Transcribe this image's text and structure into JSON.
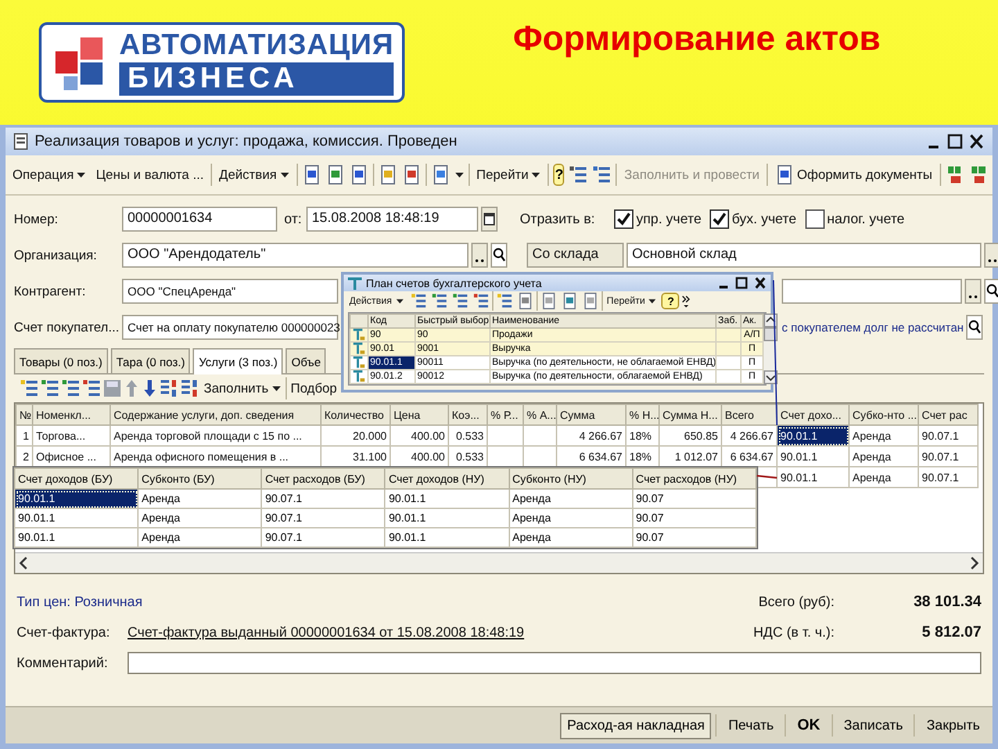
{
  "slide": {
    "title": "Формирование актов",
    "logo_top": "АВТОМАТИЗАЦИЯ",
    "logo_bottom": "БИЗНЕСА"
  },
  "window": {
    "title": "Реализация товаров и услуг: продажа, комиссия. Проведен"
  },
  "toolbar": {
    "operation": "Операция",
    "prices": "Цены и валюта ...",
    "actions": "Действия",
    "goto": "Перейти",
    "help": "?",
    "fill_post": "Заполнить и провести",
    "make_docs": "Оформить документы"
  },
  "form": {
    "number_label": "Номер:",
    "number": "00000001634",
    "date_label": "от:",
    "date": "15.08.2008 18:48:19",
    "reflect_label": "Отразить в:",
    "reflect": [
      {
        "label": "упр. учете",
        "checked": true
      },
      {
        "label": "бух. учете",
        "checked": true
      },
      {
        "label": "налог. учете",
        "checked": false
      }
    ],
    "org_label": "Организация:",
    "org": "ООО \"Арендодатель\"",
    "warehouse_label": "Со склада",
    "warehouse": "Основной склад",
    "contractor_label": "Контрагент:",
    "contractor": "ООО \"СпецАренда\"",
    "invoice_label": "Счет покупател...",
    "invoice": "Счет на оплату покупателю 000000023",
    "debt_note": "с покупателем долг не рассчитан"
  },
  "tabs": [
    {
      "label": "Товары (0 поз.)",
      "selected": false
    },
    {
      "label": "Тара (0 поз.)",
      "selected": false
    },
    {
      "label": "Услуги (3 поз.)",
      "selected": true
    },
    {
      "label": "Объе",
      "selected": false
    }
  ],
  "table_toolbar": {
    "fill": "Заполнить",
    "pick": "Подбор"
  },
  "table": {
    "columns": [
      "№",
      "Номенкл...",
      "Содержание услуги, доп. сведения",
      "Количество",
      "Цена",
      "Коэ...",
      "% Р...",
      "% А...",
      "Сумма",
      "% Н...",
      "Сумма Н...",
      "Всего",
      "Счет дохо...",
      "Субко-нто ...",
      "Счет рас"
    ],
    "rows": [
      {
        "selected": true,
        "cells": [
          "1",
          "Торгова...",
          "Аренда торговой площади с 15 по ...",
          "20.000",
          "400.00",
          "0.533",
          null,
          null,
          "4 266.67",
          "18%",
          "650.85",
          "4 266.67",
          "90.01.1",
          "Аренда",
          "90.07.1"
        ]
      },
      {
        "selected": false,
        "cells": [
          "2",
          "Офисное ...",
          "Аренда офисного помещения в ...",
          "31.100",
          "400.00",
          "0.533",
          null,
          null,
          "6 634.67",
          "18%",
          "1 012.07",
          "6 634.67",
          "90.01.1",
          "Аренда",
          "90.07.1"
        ]
      },
      {
        "selected": false,
        "cells": [
          null,
          null,
          null,
          null,
          null,
          null,
          null,
          null,
          null,
          null,
          null,
          null,
          "90.01.1",
          "Аренда",
          "90.07.1"
        ]
      }
    ]
  },
  "zoom_table": {
    "columns": [
      "Счет доходов (БУ)",
      "Субконто (БУ)",
      "Счет расходов (БУ)",
      "Счет доходов (НУ)",
      "Субконто (НУ)",
      "Счет расходов (НУ)"
    ],
    "rows": [
      {
        "selected": true,
        "cells": [
          "90.01.1",
          "Аренда",
          "90.07.1",
          "90.01.1",
          "Аренда",
          "90.07"
        ]
      },
      {
        "selected": false,
        "cells": [
          "90.01.1",
          "Аренда",
          "90.07.1",
          "90.01.1",
          "Аренда",
          "90.07"
        ]
      },
      {
        "selected": false,
        "cells": [
          "90.01.1",
          "Аренда",
          "90.07.1",
          "90.01.1",
          "Аренда",
          "90.07"
        ]
      }
    ]
  },
  "popup": {
    "title": "План счетов бухгалтерского учета",
    "actions": "Действия",
    "goto": "Перейти",
    "help": "?",
    "columns": {
      "code": "Код",
      "quick": "Быстрый выбор",
      "name": "Наименование",
      "off_balance": "Заб.",
      "type": "Ак."
    },
    "rows": [
      {
        "kind": "group",
        "selected": false,
        "code": "90",
        "quick": "90",
        "name": "Продажи",
        "type": "А/П"
      },
      {
        "kind": "group",
        "selected": false,
        "code": "90.01",
        "quick": "9001",
        "name": "Выручка",
        "type": "П"
      },
      {
        "kind": "account",
        "selected": true,
        "code": "90.01.1",
        "quick": "90011",
        "name": "Выручка (по деятельности, не облагаемой ЕНВД)",
        "type": "П"
      },
      {
        "kind": "account",
        "selected": false,
        "code": "90.01.2",
        "quick": "90012",
        "name": "Выручка (по деятельности, облагаемой ЕНВД)",
        "type": "П"
      }
    ]
  },
  "footer": {
    "price_type": "Тип цен: Розничная",
    "total_label": "Всего (руб):",
    "total": "38 101.34",
    "invoice_label": "Счет-фактура:",
    "invoice_link": "Счет-фактура выданный 00000001634 от 15.08.2008 18:48:19",
    "vat_label": "НДС (в т. ч.):",
    "vat": "5 812.07",
    "comment_label": "Комментарий:"
  },
  "buttons": [
    {
      "label": "Расход-ая накладная",
      "kind": "framed"
    },
    {
      "label": "Печать",
      "kind": "flat"
    },
    {
      "label": "OK",
      "kind": "bold"
    },
    {
      "label": "Записать",
      "kind": "flat"
    },
    {
      "label": "Закрыть",
      "kind": "flat"
    }
  ]
}
